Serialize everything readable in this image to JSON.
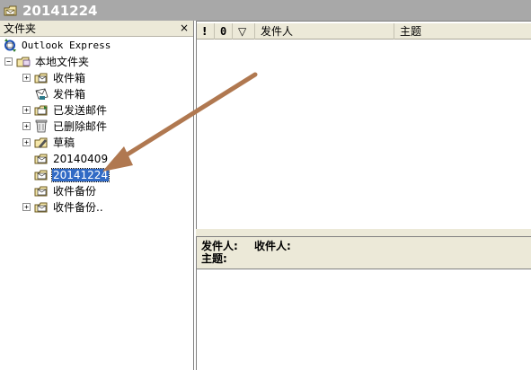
{
  "window": {
    "title": "20141224",
    "icon": "folder-envelope-icon"
  },
  "folder_pane": {
    "header_label": "文件夹",
    "close_glyph": "×",
    "tree": [
      {
        "label": "Outlook Express",
        "icon": "outlook-express-icon",
        "expander": ""
      },
      {
        "label": "本地文件夹",
        "icon": "local-folders-icon",
        "expander": "−"
      },
      {
        "label": "收件箱",
        "icon": "inbox-icon",
        "expander": "+"
      },
      {
        "label": "发件箱",
        "icon": "outbox-icon",
        "expander": ""
      },
      {
        "label": "已发送邮件",
        "icon": "sent-items-icon",
        "expander": "+"
      },
      {
        "label": "已删除邮件",
        "icon": "deleted-items-icon",
        "expander": "+"
      },
      {
        "label": "草稿",
        "icon": "drafts-icon",
        "expander": "+"
      },
      {
        "label": "20140409",
        "icon": "folder-icon",
        "expander": ""
      },
      {
        "label": "20141224",
        "icon": "folder-icon",
        "expander": "",
        "selected": true
      },
      {
        "label": "收件备份",
        "icon": "folder-icon",
        "expander": ""
      },
      {
        "label": "收件备份..",
        "icon": "folder-icon",
        "expander": "+"
      }
    ]
  },
  "message_list": {
    "columns": [
      "!",
      "0",
      "▽",
      "发件人",
      "主题"
    ]
  },
  "preview_pane": {
    "from_label": "发件人:",
    "to_label": "收件人:",
    "subject_label": "主题:"
  },
  "annotation": {
    "arrow_color": "#b07850"
  }
}
